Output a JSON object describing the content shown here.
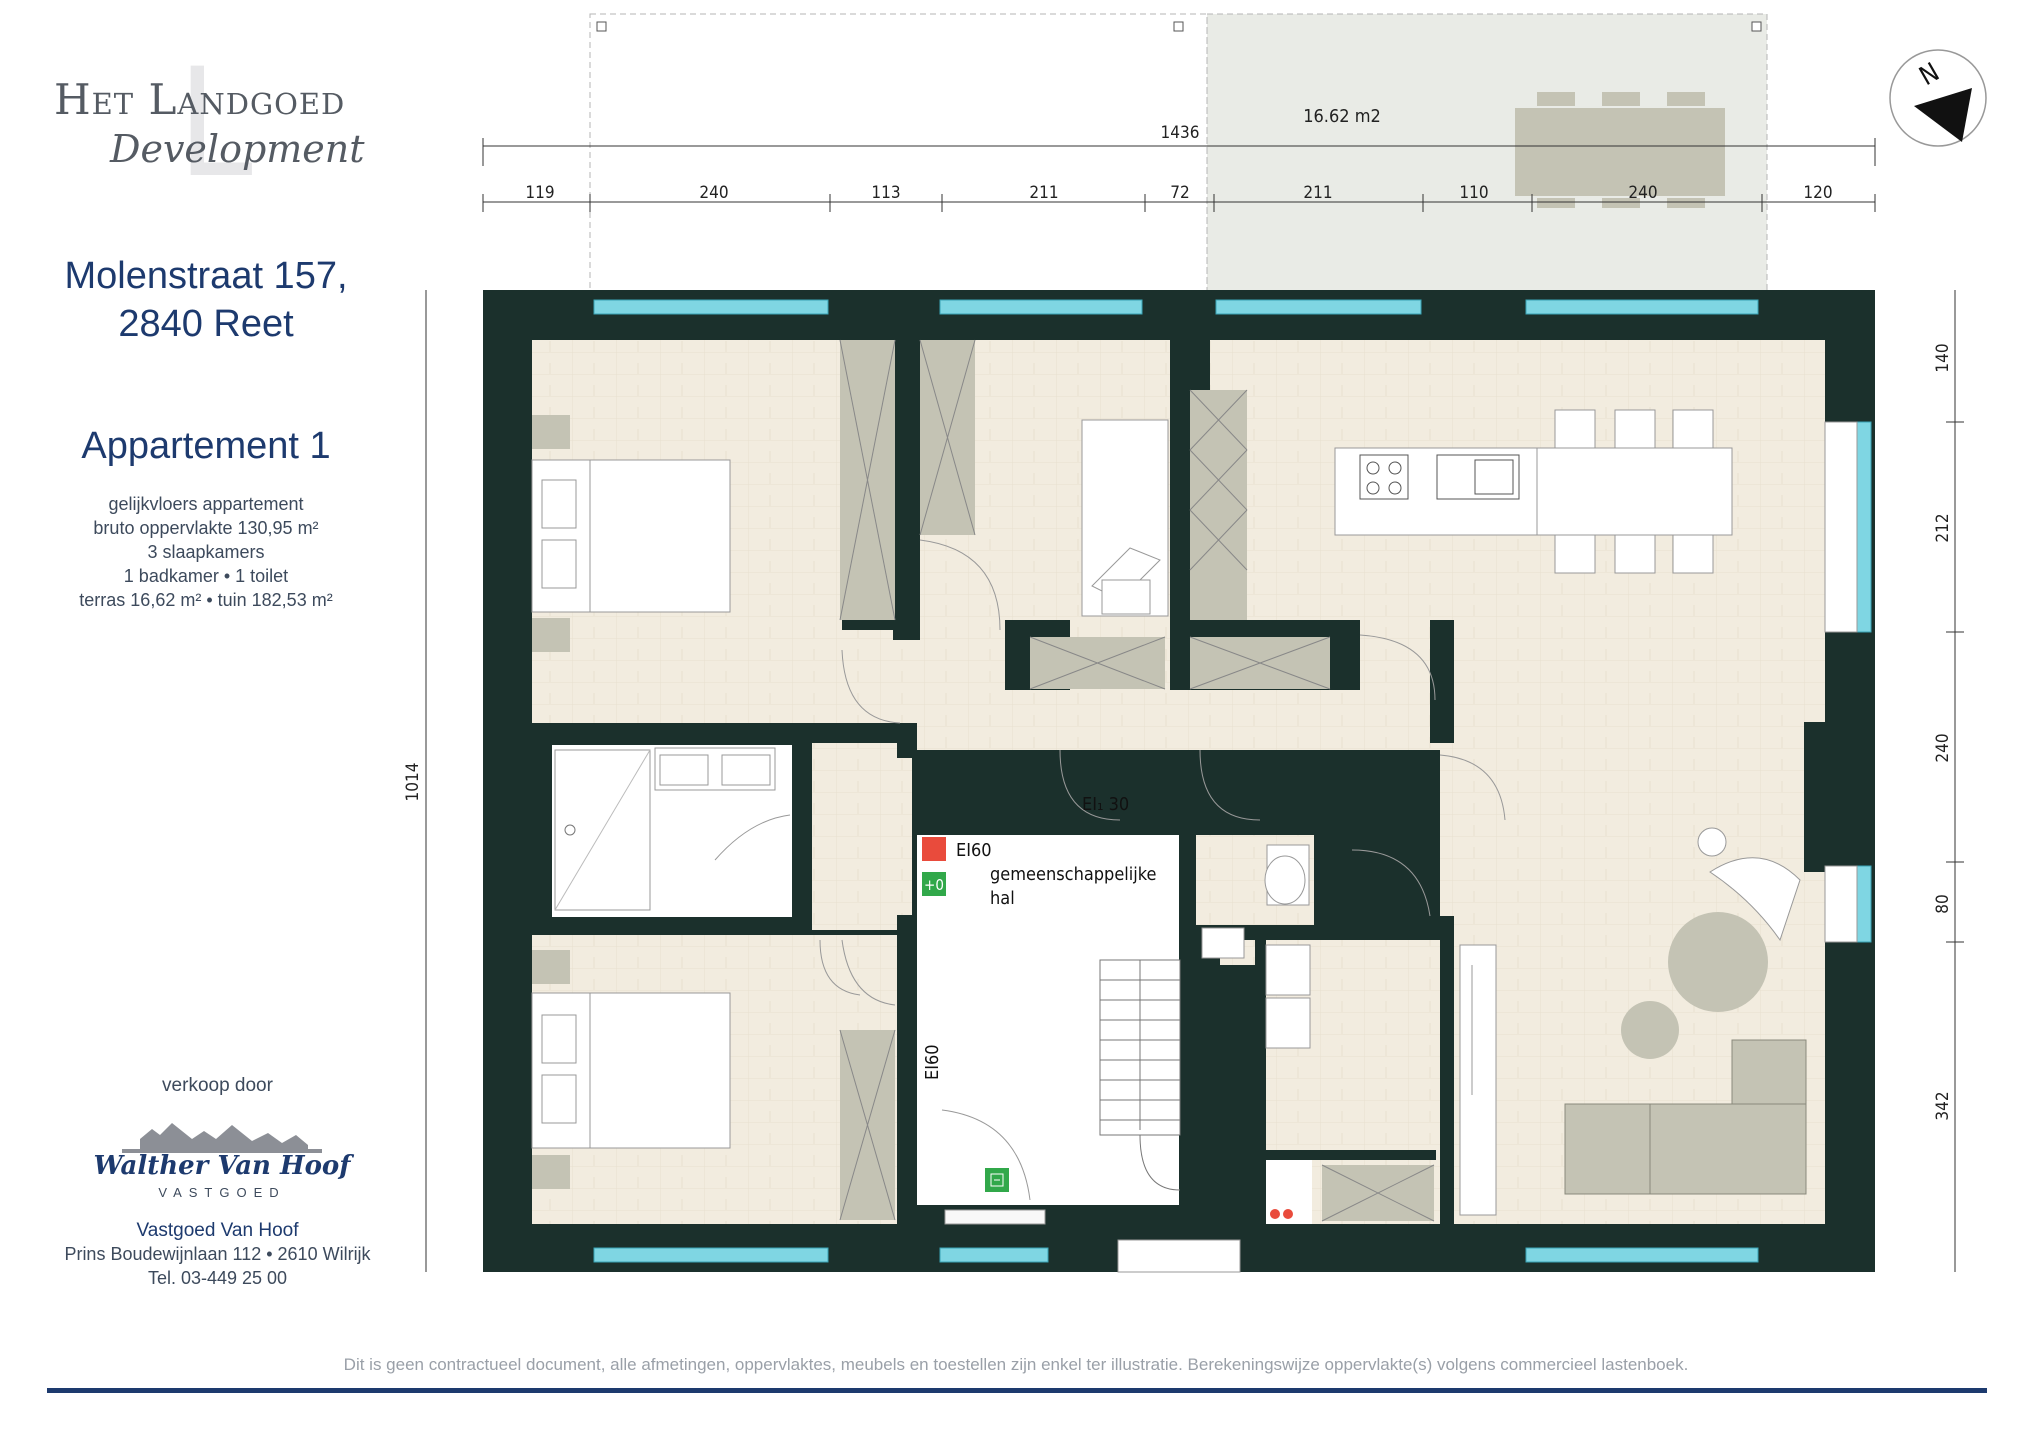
{
  "brand": {
    "line1": "Het Landgoed",
    "line2": "Development"
  },
  "address": {
    "street": "Molenstraat 157,",
    "city": "2840 Reet"
  },
  "apartment": {
    "title": "Appartement 1",
    "details": [
      "gelijkvloers appartement",
      "bruto oppervlakte 130,95 m²",
      "3 slaapkamers",
      "1 badkamer • 1 toilet",
      "terras 16,62 m² • tuin 182,53 m²"
    ]
  },
  "seller": {
    "label": "verkoop door",
    "logo_name": "Walther Van Hoof",
    "logo_sub": "VASTGOED",
    "company": "Vastgoed Van Hoof",
    "street": "Prins Boudewijnlaan 112  •  2610 Wilrijk",
    "phone": "Tel. 03-449 25 00"
  },
  "plan": {
    "terrace_area": "16.62  m2",
    "total_width": "1436",
    "total_depth": "1014",
    "top_dims": [
      "119",
      "240",
      "113",
      "211",
      "72",
      "211",
      "110",
      "240",
      "120"
    ],
    "right_dims": [
      "140",
      "212",
      "240",
      "80",
      "342"
    ],
    "fire_door": "EI₁ 30",
    "hall_label_1": "gemeenschappelijke",
    "hall_label_2": "hal",
    "ei60_top": "EI60",
    "ei60_side": "EI60",
    "level_marker": "+0",
    "north": "N"
  },
  "disclaimer": "Dit is geen contractueel document, alle afmetingen, oppervlaktes, meubels en toestellen zijn enkel ter illustratie. Berekeningswijze oppervlakte(s) volgens commercieel lastenboek.",
  "colors": {
    "wall": "#1b302c",
    "floor": "#f2ecdf",
    "furniture": "#c4c3b4",
    "glass": "#7fd6e3",
    "brand_navy": "#1d3a6e"
  }
}
